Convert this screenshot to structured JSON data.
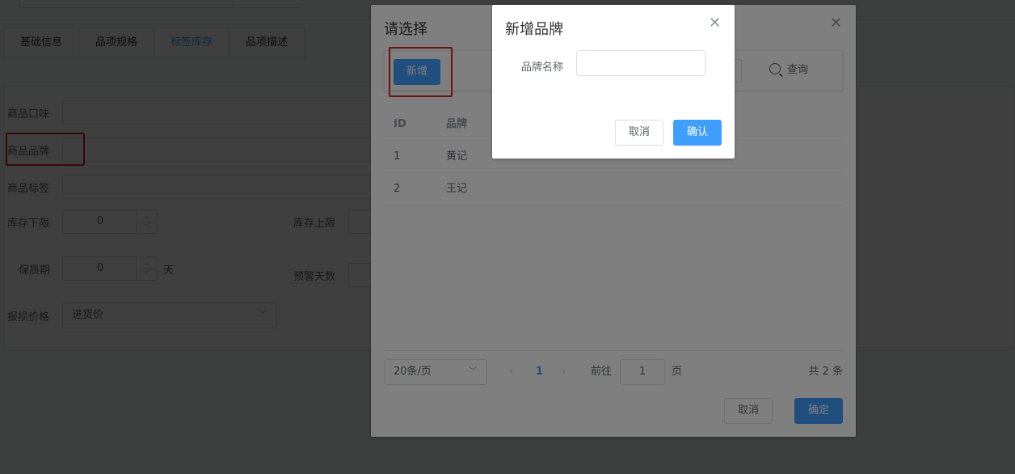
{
  "background": {
    "tabs": [
      {
        "label": "基础信息",
        "active": false
      },
      {
        "label": "品项规格",
        "active": false
      },
      {
        "label": "标签库存",
        "active": true
      },
      {
        "label": "品项描述",
        "active": false
      }
    ],
    "form": {
      "flavor_label": "商品口味",
      "brand_label": "商品品牌",
      "tag_label": "商品标签",
      "stock_min_label": "库存下限",
      "stock_min_value": "0",
      "stock_max_label": "库存上限",
      "shelf_life_label": "保质期",
      "shelf_life_value": "0",
      "shelf_life_unit": "天",
      "warn_days_label": "预警天数",
      "loss_price_label": "报损价格",
      "loss_price_value": "进货价"
    }
  },
  "select_dialog": {
    "title": "请选择",
    "add_button": "新增",
    "query_button": "查询",
    "columns": [
      "ID",
      "品牌"
    ],
    "rows": [
      {
        "id": "1",
        "brand": "黄记"
      },
      {
        "id": "2",
        "brand": "王记"
      }
    ],
    "pagination": {
      "page_size": "20条/页",
      "current_page": "1",
      "goto_label": "前往",
      "goto_value": "1",
      "page_unit": "页",
      "total": "共 2 条"
    },
    "cancel_button": "取消",
    "confirm_button": "确定"
  },
  "add_brand_dialog": {
    "title": "新增品牌",
    "name_label": "品牌名称",
    "name_value": "",
    "cancel_button": "取消",
    "confirm_button": "确认"
  },
  "colors": {
    "primary": "#409eff",
    "highlight": "#e02020"
  }
}
